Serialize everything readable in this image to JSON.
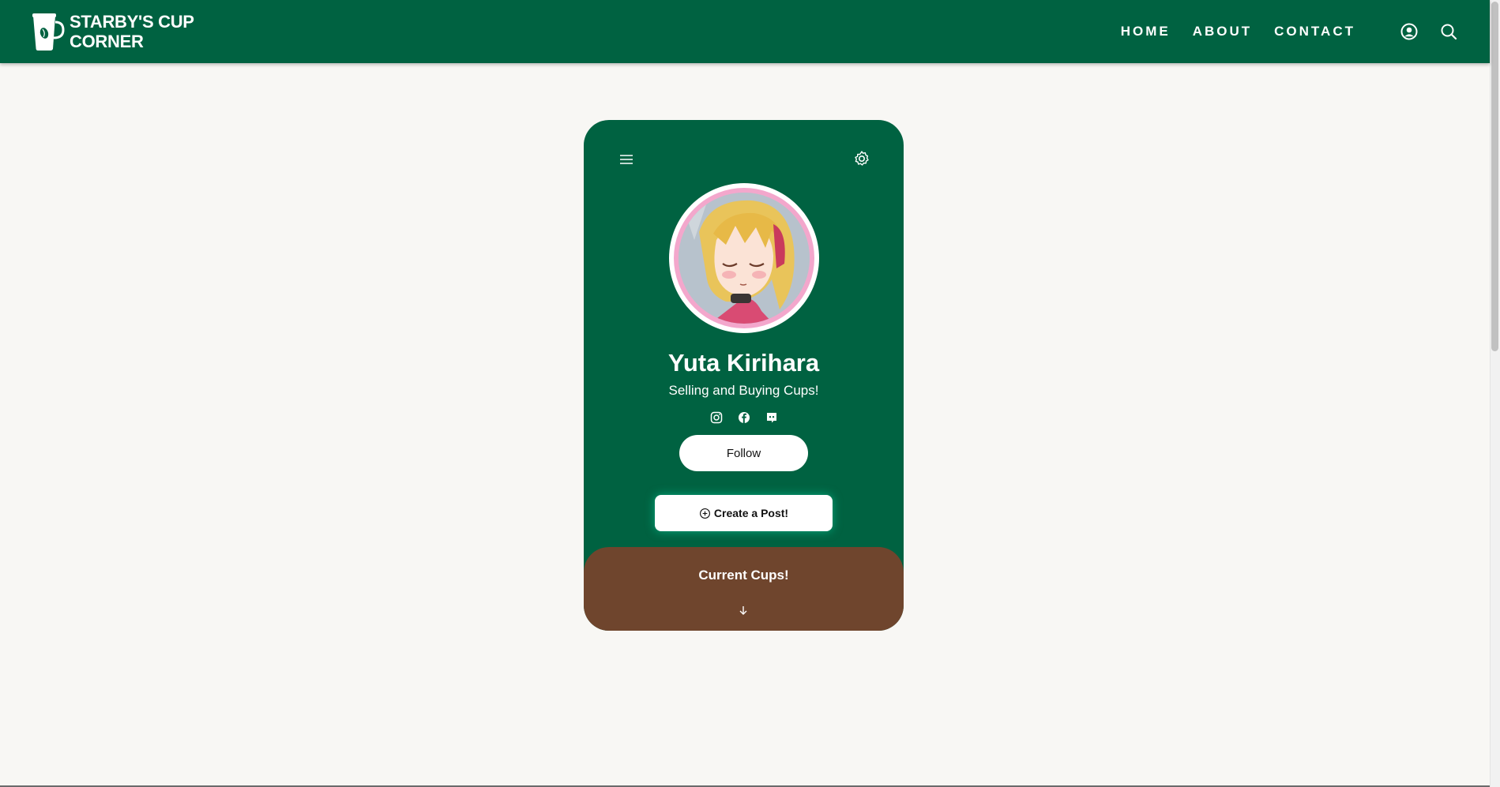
{
  "header": {
    "brand": "STARBY'S CUP CORNER",
    "nav": [
      "HOME",
      "ABOUT",
      "CONTACT"
    ],
    "icons": [
      "user-circle-icon",
      "search-icon"
    ]
  },
  "profile": {
    "name": "Yuta Kirihara",
    "tagline": "Selling and Buying Cups!",
    "socials": [
      "instagram-icon",
      "facebook-icon",
      "discord-icon"
    ],
    "follow_label": "Follow",
    "create_post_label": "Create a Post!",
    "current_cups_label": "Current Cups!"
  },
  "colors": {
    "primary_green": "#006241",
    "brown": "#6f452d",
    "background": "#f8f7f4",
    "avatar_ring": "#f3a7cc"
  }
}
